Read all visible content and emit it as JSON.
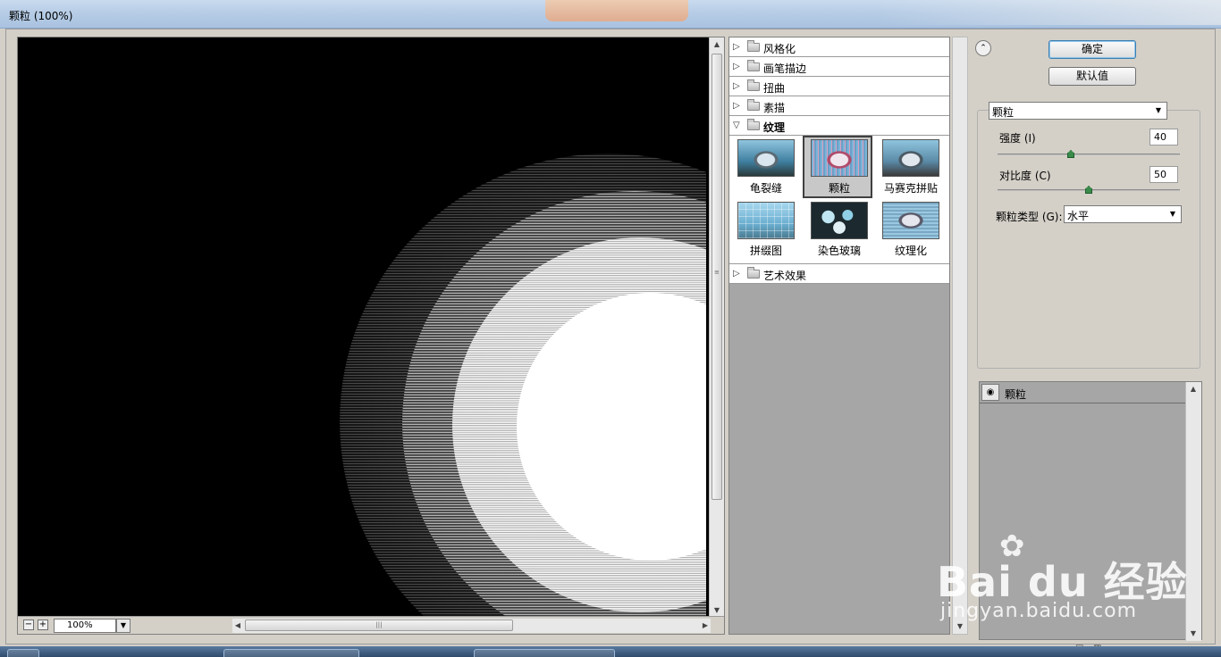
{
  "window": {
    "title": "颗粒 (100%)"
  },
  "preview": {
    "zoom": "100%"
  },
  "gallery": {
    "categories": [
      {
        "label": "风格化",
        "expanded": false
      },
      {
        "label": "画笔描边",
        "expanded": false
      },
      {
        "label": "扭曲",
        "expanded": false
      },
      {
        "label": "素描",
        "expanded": false
      },
      {
        "label": "纹理",
        "expanded": true
      },
      {
        "label": "艺术效果",
        "expanded": false
      }
    ],
    "texture_filters": [
      {
        "label": "龟裂缝",
        "selected": false
      },
      {
        "label": "颗粒",
        "selected": true
      },
      {
        "label": "马赛克拼贴",
        "selected": false
      },
      {
        "label": "拼缀图",
        "selected": false
      },
      {
        "label": "染色玻璃",
        "selected": false
      },
      {
        "label": "纹理化",
        "selected": false
      }
    ]
  },
  "buttons": {
    "ok": "确定",
    "defaults": "默认值"
  },
  "settings": {
    "filter_select": "颗粒",
    "intensity_label": "强度 (I)",
    "intensity_value": "40",
    "intensity_fraction": 0.4,
    "contrast_label": "对比度 (C)",
    "contrast_value": "50",
    "contrast_fraction": 0.5,
    "grain_type_label": "颗粒类型 (G):",
    "grain_type_value": "水平"
  },
  "layers": {
    "items": [
      {
        "label": "颗粒"
      }
    ]
  },
  "watermark": {
    "brand": "Bai du 经验",
    "url": "jingyan.baidu.com"
  },
  "colors": {
    "dialog_bg": "#d4d0c8",
    "panel_gray": "#a6a6a6",
    "title_bar": "#b7cde6",
    "slider_knob": "#3a8a4a"
  }
}
